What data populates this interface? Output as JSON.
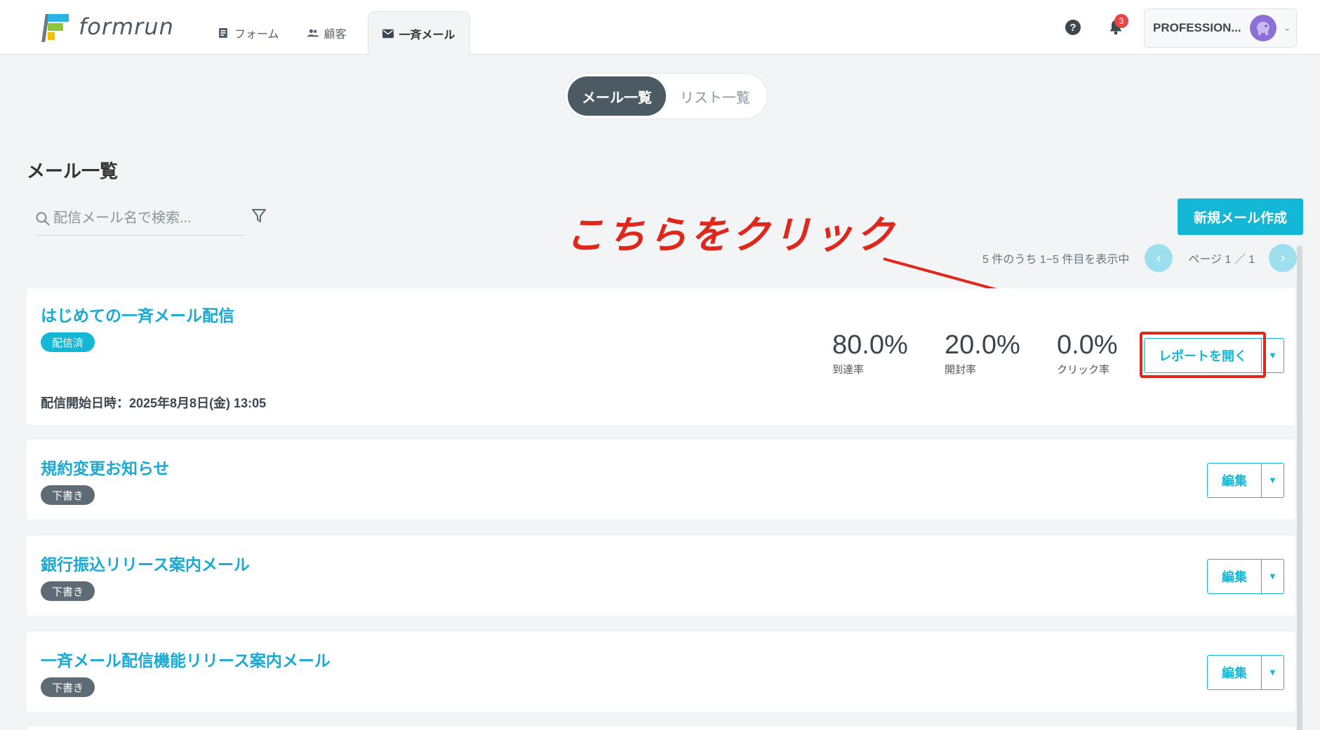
{
  "header": {
    "logo_text": "formrun",
    "nav": [
      {
        "label": "フォーム",
        "icon": "form-icon"
      },
      {
        "label": "顧客",
        "icon": "people-icon"
      },
      {
        "label": "一斉メール",
        "icon": "mail-icon"
      }
    ],
    "notification_count": "3",
    "account_name": "PROFESSION..."
  },
  "segment": {
    "mail_list": "メール一覧",
    "list_list": "リスト一覧"
  },
  "page_title": "メール一覧",
  "search": {
    "placeholder": "配信メール名で検索..."
  },
  "new_mail_button": "新規メール作成",
  "annotation": "こちらをクリック",
  "pagination": {
    "summary": "5 件のうち 1−5 件目を表示中",
    "page": "ページ 1 ／ 1",
    "prev": "‹",
    "next": "›"
  },
  "mails": [
    {
      "title": "はじめての一斉メール配信",
      "status": "配信済",
      "sent_at": "配信開始日時：2025年8月8日(金) 13:05",
      "stats": [
        {
          "value": "80.0%",
          "label": "到達率"
        },
        {
          "value": "20.0%",
          "label": "開封率"
        },
        {
          "value": "0.0%",
          "label": "クリック率"
        }
      ],
      "action": "レポートを開く"
    },
    {
      "title": "規約変更お知らせ",
      "status": "下書き",
      "action": "編集"
    },
    {
      "title": "銀行振込リリース案内メール",
      "status": "下書き",
      "action": "編集"
    },
    {
      "title": "一斉メール配信機能リリース案内メール",
      "status": "下書き",
      "action": "編集"
    }
  ],
  "colors": {
    "accent": "#14b8d6",
    "annotation": "#e0271b",
    "draft_badge": "#5e6b74"
  }
}
